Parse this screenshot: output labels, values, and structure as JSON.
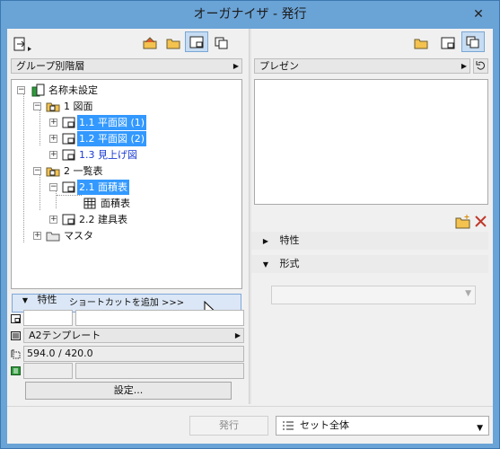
{
  "window": {
    "title": "オーガナイザ - 発行",
    "close_glyph": "✕"
  },
  "left": {
    "view_dropdown": "グループ別階層",
    "tree": {
      "root": "名称未設定",
      "n1": "1 図面",
      "n11": "1.1 平面図 (1)",
      "n12": "1.2 平面図 (2)",
      "n13": "1.3 見上げ図",
      "n2": "2 一覧表",
      "n21": "2.1 面積表",
      "n21a": "面積表",
      "n22": "2.2 建具表",
      "master": "マスタ"
    },
    "shortcut_button": "ショートカットを追加 >>>",
    "properties_label": "特性",
    "template_dropdown": "A2テンプレート",
    "size_field": "594.0 / 420.0",
    "settings_button": "設定..."
  },
  "right": {
    "preset_dropdown": "プレゼン",
    "section_properties": "特性",
    "section_format": "形式"
  },
  "bottom": {
    "publish_button": "発行",
    "set_select": "セット全体"
  },
  "colors": {
    "titlebar": "#6aa3d6",
    "selection": "#3399ff",
    "link_blue": "#1a3ad0"
  }
}
